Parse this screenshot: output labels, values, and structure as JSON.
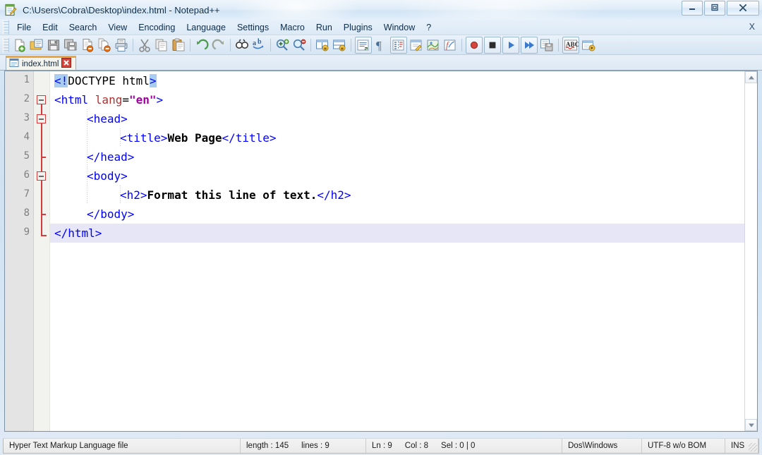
{
  "window": {
    "title": "C:\\Users\\Cobra\\Desktop\\index.html - Notepad++",
    "app_icon": "notepadpp-icon",
    "minimize_glyph": "—",
    "maximize_glyph": "□",
    "close_glyph": "✕"
  },
  "menu": {
    "items": [
      {
        "label": "File"
      },
      {
        "label": "Edit"
      },
      {
        "label": "Search"
      },
      {
        "label": "View"
      },
      {
        "label": "Encoding"
      },
      {
        "label": "Language"
      },
      {
        "label": "Settings"
      },
      {
        "label": "Macro"
      },
      {
        "label": "Run"
      },
      {
        "label": "Plugins"
      },
      {
        "label": "Window"
      },
      {
        "label": "?"
      }
    ],
    "close_document_label": "X"
  },
  "toolbar": {
    "buttons": [
      {
        "name": "new-file-icon",
        "title": "New"
      },
      {
        "name": "open-file-icon",
        "title": "Open"
      },
      {
        "name": "save-icon",
        "title": "Save"
      },
      {
        "name": "save-all-icon",
        "title": "Save All"
      },
      {
        "name": "close-file-icon",
        "title": "Close"
      },
      {
        "name": "close-all-files-icon",
        "title": "Close All"
      },
      {
        "name": "print-icon",
        "title": "Print"
      },
      {
        "name": "separator",
        "title": ""
      },
      {
        "name": "cut-icon",
        "title": "Cut"
      },
      {
        "name": "copy-icon",
        "title": "Copy"
      },
      {
        "name": "paste-icon",
        "title": "Paste"
      },
      {
        "name": "separator",
        "title": ""
      },
      {
        "name": "undo-icon",
        "title": "Undo"
      },
      {
        "name": "redo-icon",
        "title": "Redo"
      },
      {
        "name": "separator",
        "title": ""
      },
      {
        "name": "find-icon",
        "title": "Find"
      },
      {
        "name": "replace-icon",
        "title": "Replace"
      },
      {
        "name": "separator",
        "title": ""
      },
      {
        "name": "zoom-in-icon",
        "title": "Zoom In"
      },
      {
        "name": "zoom-out-icon",
        "title": "Zoom Out"
      },
      {
        "name": "separator",
        "title": ""
      },
      {
        "name": "sync-vertical-scroll-icon",
        "title": "Synchronize Vertical Scrolling"
      },
      {
        "name": "sync-horizontal-scroll-icon",
        "title": "Synchronize Horizontal Scrolling"
      },
      {
        "name": "separator",
        "title": ""
      },
      {
        "name": "word-wrap-icon",
        "title": "Word wrap"
      },
      {
        "name": "show-all-chars-icon",
        "title": "Show All Characters"
      },
      {
        "name": "indent-guide-icon",
        "title": "Show Indent Guide"
      },
      {
        "name": "user-defined-dialog-icon",
        "title": "User-Defined Dialogue"
      },
      {
        "name": "document-map-icon",
        "title": "Document Map"
      },
      {
        "name": "function-list-icon",
        "title": "Function List"
      },
      {
        "name": "separator",
        "title": ""
      },
      {
        "name": "record-macro-icon",
        "title": "Start Recording"
      },
      {
        "name": "stop-macro-icon",
        "title": "Stop Recording"
      },
      {
        "name": "play-macro-icon",
        "title": "Playback"
      },
      {
        "name": "run-macro-multiple-icon",
        "title": "Run a Macro Multiple Times"
      },
      {
        "name": "save-macro-icon",
        "title": "Save Current Recorded Macro"
      },
      {
        "name": "separator",
        "title": ""
      },
      {
        "name": "spellcheck-icon",
        "title": "Spell Check"
      },
      {
        "name": "run-icon",
        "title": "Run"
      }
    ]
  },
  "tabs": [
    {
      "label": "index.html",
      "icon": "html-file-icon",
      "close_glyph": "✕",
      "active": true
    }
  ],
  "editor": {
    "line_count": 9,
    "line_numbers": [
      "1",
      "2",
      "3",
      "4",
      "5",
      "6",
      "7",
      "8",
      "9"
    ],
    "current_line": 9,
    "folds": [
      {
        "line": 2,
        "type": "box"
      },
      {
        "line": 3,
        "type": "box"
      },
      {
        "line": 5,
        "type": "tick"
      },
      {
        "line": 6,
        "type": "box"
      },
      {
        "line": 8,
        "type": "tick"
      },
      {
        "line": 9,
        "type": "end"
      }
    ],
    "lines": [
      {
        "n": 1,
        "indent": 0,
        "tokens": [
          {
            "t": "<!",
            "c": "tag matchhl"
          },
          {
            "t": "DOCTYPE html",
            "c": "plain"
          },
          {
            "t": ">",
            "c": "tag matchhl"
          }
        ]
      },
      {
        "n": 2,
        "indent": 0,
        "tokens": [
          {
            "t": "<html ",
            "c": "tag"
          },
          {
            "t": "lang",
            "c": "attr"
          },
          {
            "t": "=",
            "c": "plain"
          },
          {
            "t": "\"en\"",
            "c": "val"
          },
          {
            "t": ">",
            "c": "tag"
          }
        ]
      },
      {
        "n": 3,
        "indent": 1,
        "tokens": [
          {
            "t": "<head>",
            "c": "tag"
          }
        ]
      },
      {
        "n": 4,
        "indent": 2,
        "tokens": [
          {
            "t": "<title>",
            "c": "tag"
          },
          {
            "t": "Web Page",
            "c": "txt"
          },
          {
            "t": "</title>",
            "c": "tag"
          }
        ]
      },
      {
        "n": 5,
        "indent": 1,
        "tokens": [
          {
            "t": "</head>",
            "c": "tag"
          }
        ]
      },
      {
        "n": 6,
        "indent": 1,
        "tokens": [
          {
            "t": "<body>",
            "c": "tag"
          }
        ]
      },
      {
        "n": 7,
        "indent": 2,
        "tokens": [
          {
            "t": "<h2>",
            "c": "tag"
          },
          {
            "t": "Format this line of text.",
            "c": "txt"
          },
          {
            "t": "</h2>",
            "c": "tag"
          }
        ]
      },
      {
        "n": 8,
        "indent": 1,
        "tokens": [
          {
            "t": "</body>",
            "c": "tag"
          }
        ]
      },
      {
        "n": 9,
        "indent": 0,
        "tokens": [
          {
            "t": "</html>",
            "c": "tag"
          }
        ]
      }
    ]
  },
  "statusbar": {
    "file_type": "Hyper Text Markup Language file",
    "length_label": "length : 145",
    "lines_label": "lines : 9",
    "ln_label": "Ln : 9",
    "col_label": "Col : 8",
    "sel_label": "Sel : 0 | 0",
    "eol": "Dos\\Windows",
    "encoding": "UTF-8 w/o BOM",
    "insert_mode": "INS"
  },
  "colors": {
    "tag": "#0000ff",
    "attribute": "#b03030",
    "attribute_value": "#a000a0",
    "text": "#000000",
    "match_highlight": "#a8cdf0",
    "current_line": "#e6e6f7",
    "fold_marker": "#d43b3b",
    "tab_active_top": "#f0a53c",
    "gutter_bg": "#e4e4e4"
  }
}
